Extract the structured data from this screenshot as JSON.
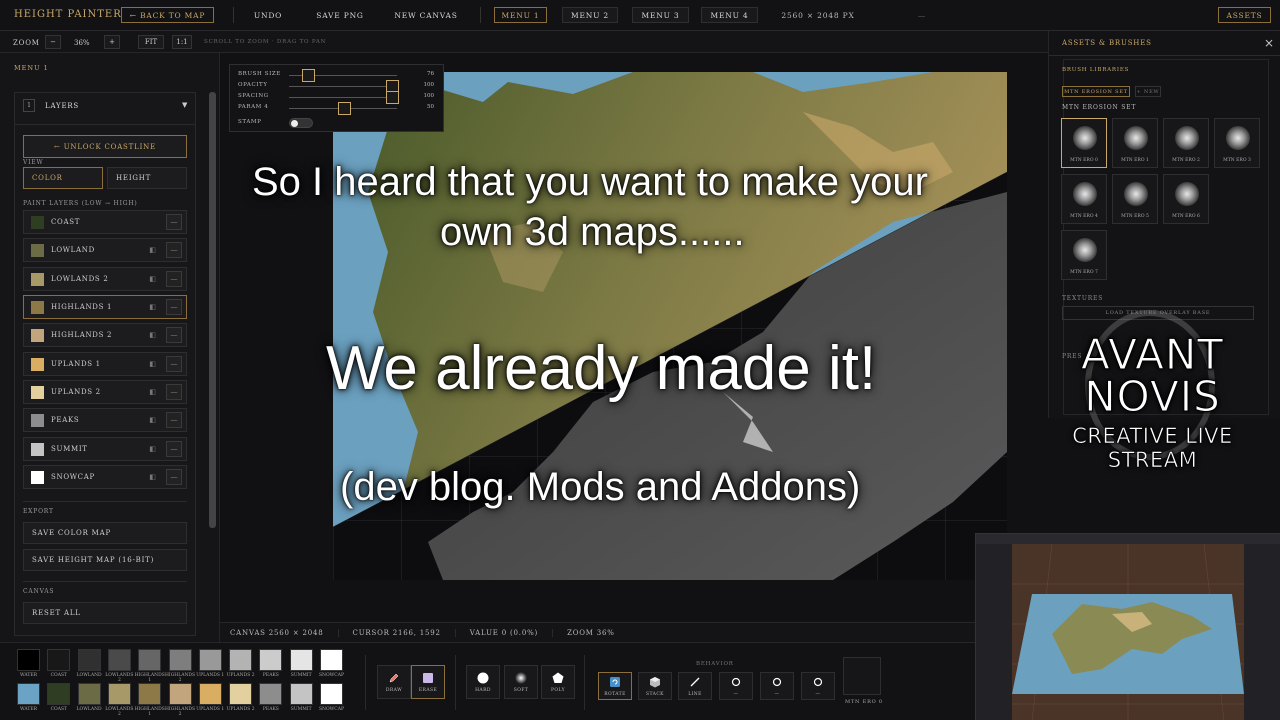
{
  "topbar": {
    "title": "Height Painter",
    "back": "← Back to Map",
    "undo": "Undo",
    "save_png": "Save PNG",
    "new_canvas": "New Canvas",
    "menu1": "Menu 1",
    "menu2": "Menu 2",
    "menu3": "Menu 3",
    "menu4": "Menu 4",
    "dims": "2560 × 2048 px",
    "dash": "—",
    "assets": "Assets"
  },
  "subbar": {
    "zoom_label": "Zoom",
    "minus": "−",
    "zoom_value": "36%",
    "plus": "+",
    "fit": "Fit",
    "one_to_one": "1:1",
    "hint": "Scroll to zoom · Drag to pan"
  },
  "leftpanel": {
    "menu_label": "Menu 1",
    "layers_num": "1",
    "layers_title": "Layers",
    "unlock": "← Unlock Coastline",
    "view_label": "View",
    "view_color": "Color",
    "view_height": "Height",
    "paint_label": "Paint layers (low → high)",
    "layers": [
      {
        "name": "Coast",
        "color": "#2f3d22"
      },
      {
        "name": "Lowland",
        "color": "#6b6b45"
      },
      {
        "name": "Lowlands 2",
        "color": "#a89a68"
      },
      {
        "name": "Highlands 1",
        "color": "#8d7848"
      },
      {
        "name": "Highlands 2",
        "color": "#c2a47d"
      },
      {
        "name": "Uplands 1",
        "color": "#d9ad62"
      },
      {
        "name": "Uplands 2",
        "color": "#e2d09e"
      },
      {
        "name": "Peaks",
        "color": "#8d8d8d"
      },
      {
        "name": "Summit",
        "color": "#c4c4c4"
      },
      {
        "name": "Snowcap",
        "color": "#ffffff"
      }
    ],
    "export_label": "Export",
    "save_color": "Save color map",
    "save_height": "Save height map (16-bit)",
    "canvas_label": "Canvas",
    "reset": "Reset all"
  },
  "hud": {
    "brush_size": {
      "label": "Brush size",
      "value": "76",
      "level": 0.12
    },
    "opacity": {
      "label": "Opacity",
      "value": "100",
      "level": 0.9
    },
    "spacing": {
      "label": "Spacing",
      "value": "100",
      "level": 0.9
    },
    "param4": {
      "label": "Param 4",
      "value": "50",
      "level": 0.45
    },
    "stamp": "Stamp"
  },
  "overlay": {
    "line1": "So I heard that you want to make your",
    "line2": "own 3d maps......",
    "line3": "We already made it!",
    "line4": "(dev blog. Mods and Addons)"
  },
  "logo": {
    "line1": "AVANT",
    "line2": "NOVIS",
    "line3": "CREATIVE LIVE STREAM"
  },
  "status": {
    "canvas": "Canvas 2560 × 2048",
    "cursor": "Cursor 2166, 1592",
    "value": "Value 0 (0.0%)",
    "zoom": "Zoom 36%"
  },
  "rightpanel": {
    "title": "Assets & Brushes",
    "close": "×",
    "libraries": "Brush libraries",
    "set_btn": "Mtn Erosion Set",
    "new_btn": "+ New",
    "set_title": "Mtn Erosion Set",
    "brushes": [
      "Mtn Ero 0",
      "Mtn Ero 1",
      "Mtn Ero 2",
      "Mtn Ero 3",
      "Mtn Ero 4",
      "Mtn Ero 5",
      "Mtn Ero 6",
      "Mtn Ero 7"
    ],
    "textures": "Textures",
    "load_tex": "Load texture overlay base",
    "pres": "Pres"
  },
  "palette": {
    "top": [
      {
        "name": "Water",
        "color": "#000000"
      },
      {
        "name": "Coast",
        "color": "#181818"
      },
      {
        "name": "Lowland",
        "color": "#303030"
      },
      {
        "name": "Lowlands 2",
        "color": "#4a4a4a"
      },
      {
        "name": "Highlands 1",
        "color": "#666666"
      },
      {
        "name": "Highlands 2",
        "color": "#7e7e7e"
      },
      {
        "name": "Uplands 1",
        "color": "#999999"
      },
      {
        "name": "Uplands 2",
        "color": "#b3b3b3"
      },
      {
        "name": "Peaks",
        "color": "#cccccc"
      },
      {
        "name": "Summit",
        "color": "#e5e5e5"
      },
      {
        "name": "Snowcap",
        "color": "#ffffff"
      }
    ],
    "bottom": [
      {
        "name": "Water",
        "color": "#6ba3c4"
      },
      {
        "name": "Coast",
        "color": "#2f3d22"
      },
      {
        "name": "Lowland",
        "color": "#6b6b45"
      },
      {
        "name": "Lowlands 2",
        "color": "#a89a68"
      },
      {
        "name": "Highlands 1",
        "color": "#8d7848"
      },
      {
        "name": "Highlands 2",
        "color": "#c2a47d"
      },
      {
        "name": "Uplands 1",
        "color": "#d9ad62"
      },
      {
        "name": "Uplands 2",
        "color": "#e2d09e"
      },
      {
        "name": "Peaks",
        "color": "#8d8d8d"
      },
      {
        "name": "Summit",
        "color": "#c4c4c4"
      },
      {
        "name": "Snowcap",
        "color": "#ffffff"
      }
    ]
  },
  "tools": {
    "draw": "Draw",
    "erase": "Erase",
    "hard": "Hard",
    "soft": "Soft",
    "poly": "Poly",
    "behavior": "Behavior",
    "rotate": "Rotate",
    "stack": "Stack",
    "line": "Line",
    "dash1": "—",
    "dash2": "—",
    "dash3": "—",
    "brush_name": "Mtn Ero 0"
  }
}
